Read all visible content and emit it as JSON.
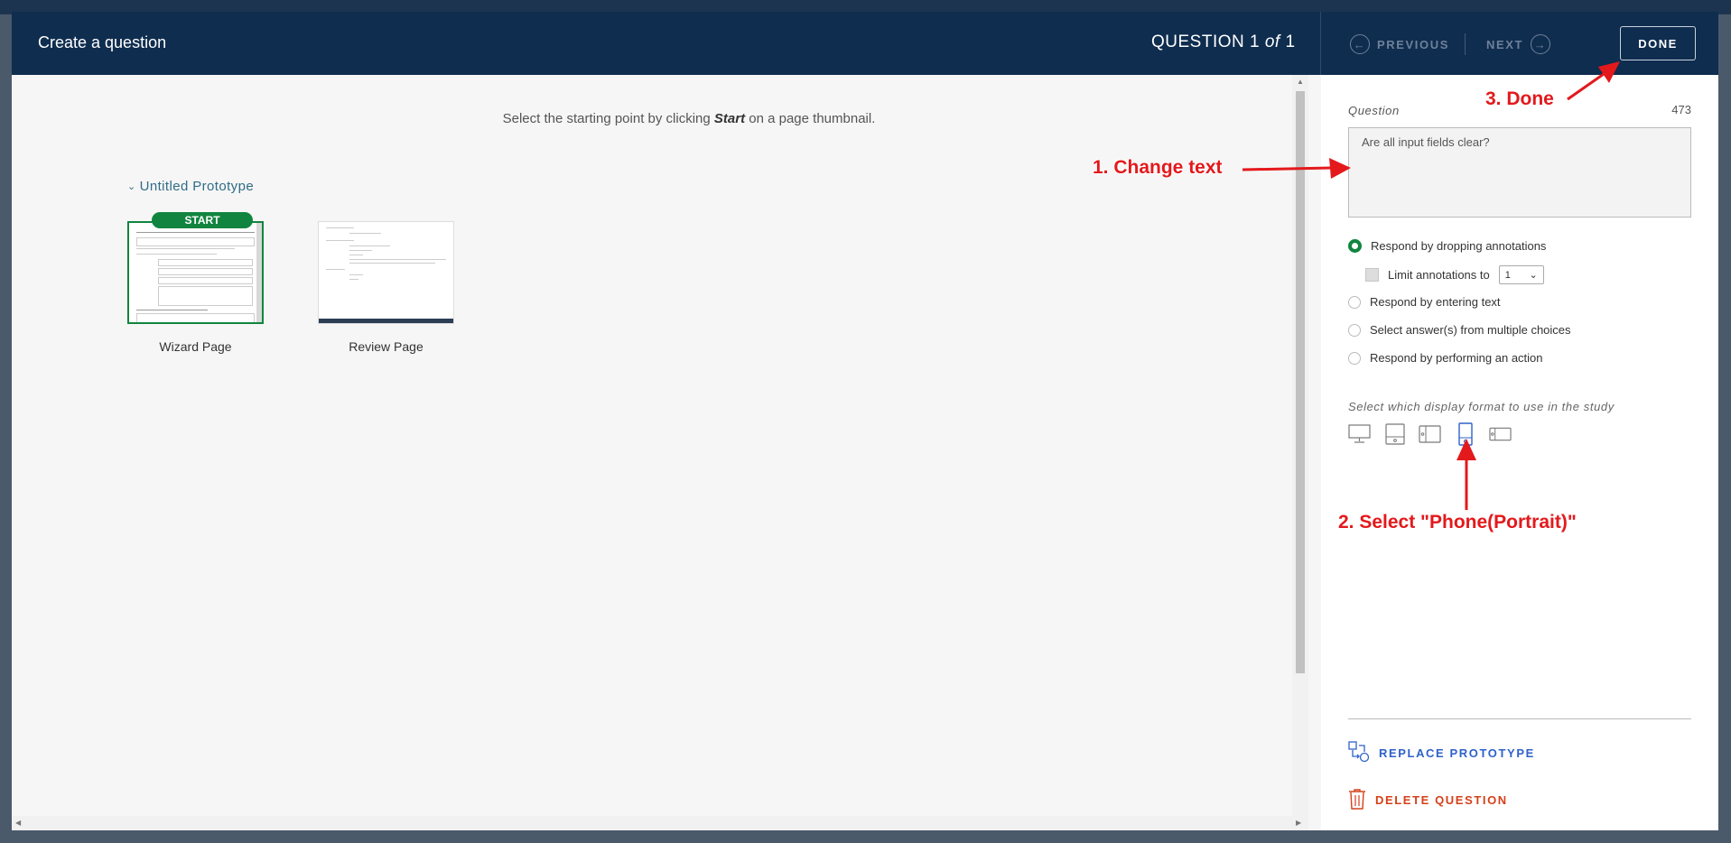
{
  "header": {
    "title": "Create a question",
    "counter_prefix": "QUESTION 1 ",
    "counter_of": "of",
    "counter_suffix": " 1",
    "previous_label": "PREVIOUS",
    "next_label": "NEXT",
    "done_label": "DONE"
  },
  "main": {
    "instruction_before": "Select the starting point by clicking ",
    "instruction_bold": "Start",
    "instruction_after": " on a page thumbnail.",
    "prototype_title": "Untitled Prototype",
    "start_badge": "START",
    "thumbnails": [
      {
        "label": "Wizard Page",
        "is_start": true
      },
      {
        "label": "Review Page",
        "is_start": false
      }
    ]
  },
  "sidebar": {
    "question_label": "Question",
    "char_count": "473",
    "question_value": "Are all input fields clear?",
    "options": [
      {
        "label": "Respond by dropping annotations",
        "selected": true
      },
      {
        "label": "Respond by entering text",
        "selected": false
      },
      {
        "label": "Select answer(s) from multiple choices",
        "selected": false
      },
      {
        "label": "Respond by performing an action",
        "selected": false
      }
    ],
    "limit_label": "Limit annotations to",
    "limit_value": "1",
    "format_label": "Select which display format to use in the study",
    "formats": [
      {
        "icon": "desktop-icon",
        "selected": false
      },
      {
        "icon": "tablet-portrait-icon",
        "selected": false
      },
      {
        "icon": "tablet-landscape-icon",
        "selected": false
      },
      {
        "icon": "phone-portrait-icon",
        "selected": true
      },
      {
        "icon": "phone-landscape-icon",
        "selected": false
      }
    ],
    "replace_label": "REPLACE PROTOTYPE",
    "delete_label": "DELETE QUESTION"
  },
  "annotations": {
    "step1": "1. Change text",
    "step2": "2. Select \"Phone(Portrait)\"",
    "step3": "3. Done"
  },
  "colors": {
    "header_bg": "#0f2d4f",
    "accent_green": "#11853f",
    "link_blue": "#2f62c9",
    "danger_red": "#d4401a",
    "annotation_red": "#e3191c"
  }
}
